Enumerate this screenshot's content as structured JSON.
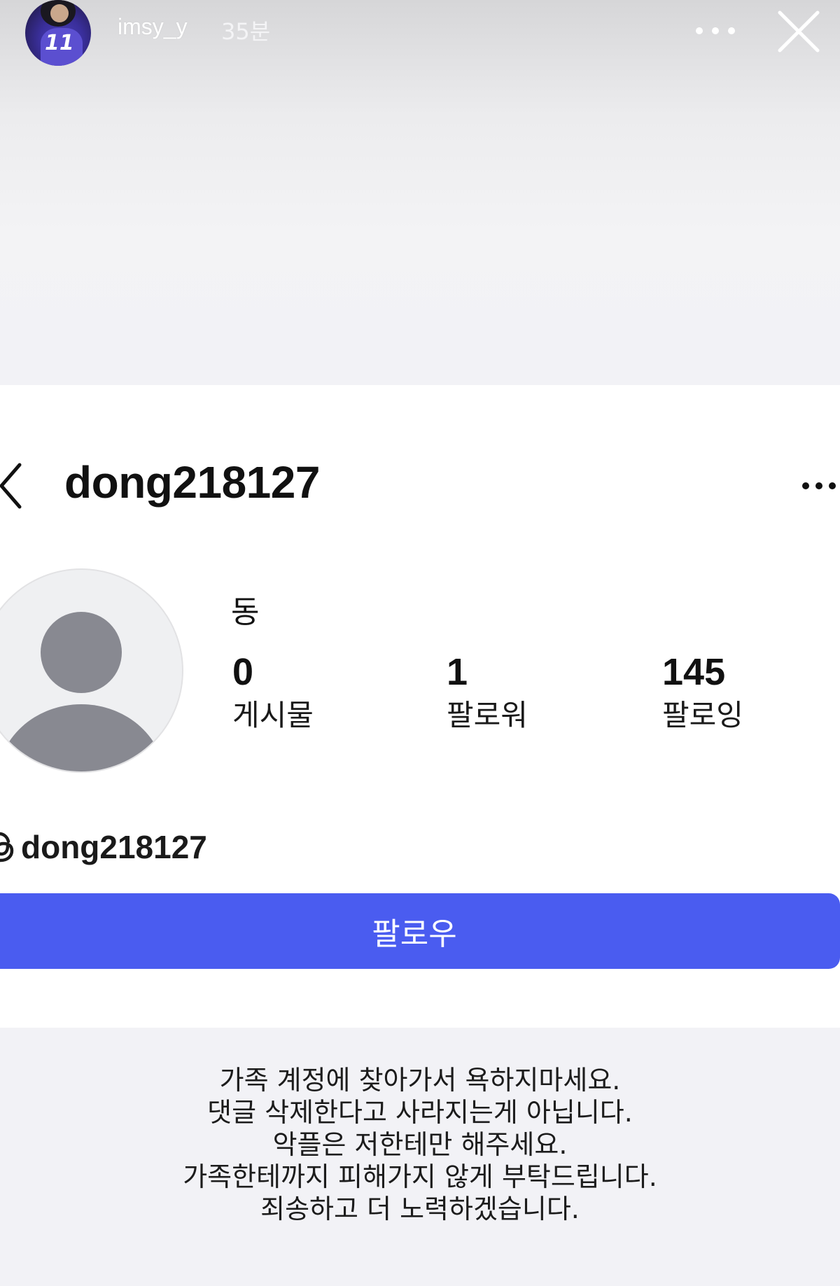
{
  "story": {
    "username": "imsy_y",
    "time": "35분",
    "avatar_icon": "profile-photo",
    "jersey_number": "11",
    "more_icon": "more-horizontal-icon",
    "close_icon": "close-icon"
  },
  "profile": {
    "handle": "dong218127",
    "back_icon": "chevron-left-icon",
    "more_icon": "more-horizontal-icon",
    "display_name": "동",
    "stats": [
      {
        "value": "0",
        "label": "게시물"
      },
      {
        "value": "1",
        "label": "팔로워"
      },
      {
        "value": "145",
        "label": "팔로잉"
      }
    ],
    "threads_icon": "threads-icon",
    "threads_handle": "dong218127",
    "follow_label": "팔로우",
    "follow_color": "#4a5cf0"
  },
  "caption": {
    "lines": [
      "가족 계정에 찾아가서 욕하지마세요.",
      "댓글 삭제한다고 사라지는게 아닙니다.",
      "악플은 저한테만 해주세요.",
      "가족한테까지 피해가지 않게 부탁드립니다.",
      "죄송하고 더 노력하겠습니다."
    ]
  }
}
